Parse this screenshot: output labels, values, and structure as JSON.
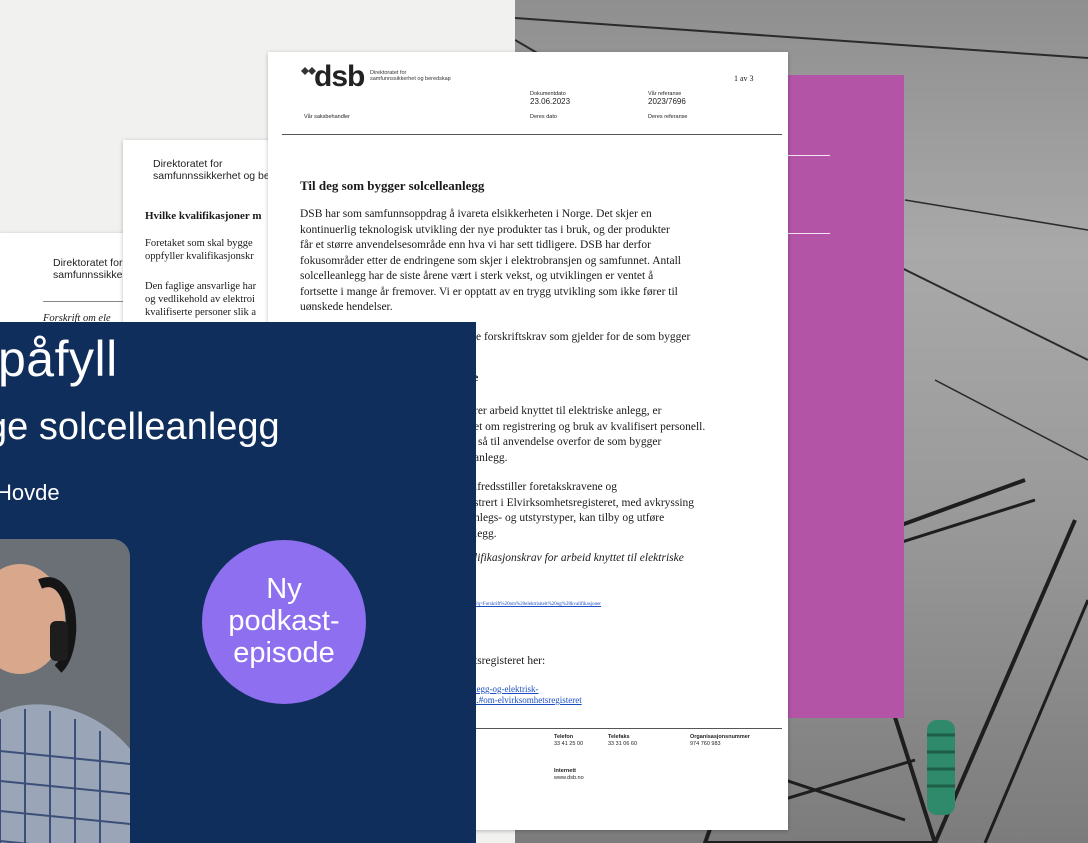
{
  "sheet_back": {
    "org_line1": "Direktoratet for",
    "org_line2": "samfunnssikke",
    "italic_line": "Forskrift om ele"
  },
  "sheet_mid": {
    "org_line1": "Direktoratet for",
    "org_line2": "samfunnssikkerhet og ber",
    "heading": "Hvilke kvalifikasjoner m",
    "p1_l1": "Foretaket som skal bygge",
    "p1_l2": "oppfyller kvalifikasjonskr",
    "p2_l1": "Den faglige ansvarlige har",
    "p2_l2": "og vedlikehold av elektroi",
    "p2_l3": "kvalifiserte personer slik a"
  },
  "letter": {
    "logo_text": "dsb",
    "agency_l1": "Direktoratet for",
    "agency_l2": "samfunnssikkerhet og beredskap",
    "page_indicator": "1 av 3",
    "doc_date_label": "Dokumentdato",
    "doc_date": "23.06.2023",
    "our_ref_label": "Vår referanse",
    "our_ref": "2023/7696",
    "handler_label": "Vår saksbehandler",
    "your_date_label": "Deres dato",
    "your_ref_label": "Deres referanse",
    "title": "Til deg som bygger solcelleanlegg",
    "para1": [
      "DSB har som samfunnsoppdrag å ivareta elsikkerheten i Norge. Det skjer en",
      "kontinuerlig teknologisk utvikling der nye produkter tas i bruk, og der produkter",
      "får et større anvendelsesområde enn hva vi har sett tidligere. DSB har derfor",
      "fokusområder etter de endringene som skjer i elektrobransjen og samfunnet. Antall",
      "solcelleanlegg har de siste årene vært i sterk vekst, og utviklingen er ventet å",
      "fortsette i mange år fremover. Vi er opptatt av en trygg utvikling som ikke fører til",
      "uønskede hendelser."
    ],
    "para2": "e forskriftskrav som gjelder for de som bygger",
    "bold_frag": "e",
    "para3": [
      "rer arbeid knyttet til elektriske anlegg, er",
      "et om registrering og bruk av kvalifisert personell.",
      "så til anvendelse overfor de som bygger",
      "anlegg."
    ],
    "para4": [
      "lfredsstiller foretakskravene og",
      "strert i Elvirksomhetsregisteret, med avkryssing",
      "nlegs- og utstyrstyper, kan tilby og utføre",
      "legg."
    ],
    "italic": "lifikasjonskrav for arbeid knyttet til elektriske",
    "small_link": "/?q=Forskrift%20om%20elektrisiteit%20og%20kvalifikasjoner",
    "register_line": "tsregisteret her:",
    "link_l1": "legg-og-elektrisk-",
    "link_l2": "t.#om-elvirksomhetsregisteret",
    "footer": {
      "phone_label": "Telefon",
      "phone": "33 41 25 00",
      "fax_label": "Telefaks",
      "fax": "33 31 06 60",
      "org_label": "Organisasjonsnummer",
      "org": "974 760 983",
      "web_label": "Internett",
      "web": "www.dsb.no",
      "mail_frag": "no"
    }
  },
  "podcast": {
    "title": "påfyll",
    "subtitle": "ge solcelleanlegg",
    "guest": "Hovde",
    "badge": "Ny\npodkast-\nepisode"
  },
  "colors": {
    "podcast_bg": "#0f2e5c",
    "badge": "#8e6ff0",
    "magenta": "#b354a6"
  }
}
